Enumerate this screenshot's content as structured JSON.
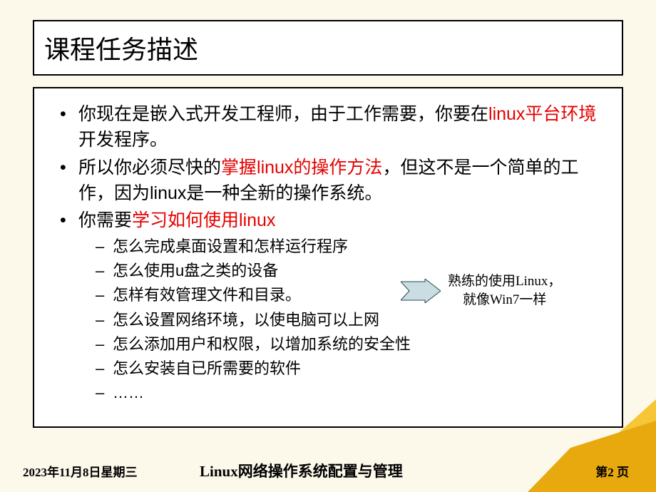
{
  "title": "课程任务描述",
  "b1": {
    "p1": "你现在是嵌入式开发工程师，由于工作需要，你要在",
    "hl1": "linux平台环境",
    "p2": "开发程序。"
  },
  "b2": {
    "p1": "所以你必须尽快的",
    "hl1": "掌握linux的操作方法",
    "p2": "，但这不是一个简单的工作，因为linux是一种全新的操作系统。"
  },
  "b3": {
    "p1": "你需要",
    "hl1": "学习如何使用linux"
  },
  "sub": [
    "怎么完成桌面设置和怎样运行程序",
    "怎么使用u盘之类的设备",
    "怎样有效管理文件和目录。",
    "怎么设置网络环境，以使电脑可以上网",
    "怎么添加用户和权限，以增加系统的安全性",
    "怎么安装自已所需要的软件",
    "……"
  ],
  "callout": {
    "line1": "熟练的使用Linux，",
    "line2": "就像Win7一样"
  },
  "footer": {
    "date": "2023年11月8日星期三",
    "title": "Linux网络操作系统配置与管理",
    "page": "第2 页"
  }
}
